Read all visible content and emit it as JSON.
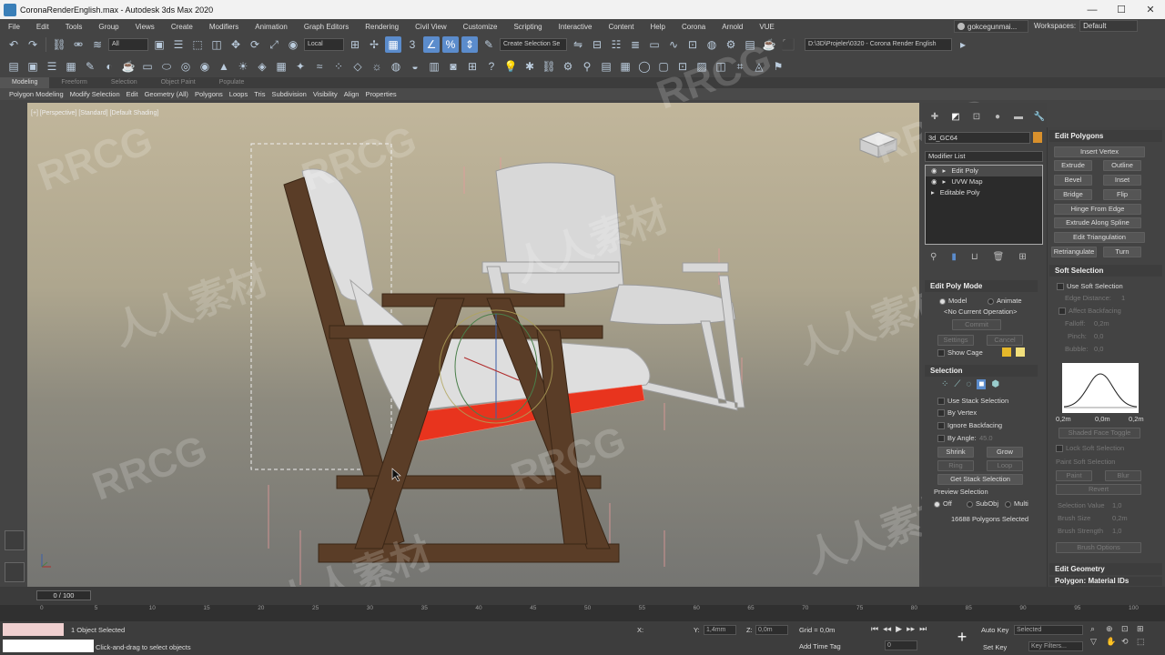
{
  "window": {
    "title": "CoronaRenderEnglish.max - Autodesk 3ds Max 2020",
    "controls": [
      "—",
      "☐",
      "✕"
    ]
  },
  "menu": [
    "File",
    "Edit",
    "Tools",
    "Group",
    "Views",
    "Create",
    "Modifiers",
    "Animation",
    "Graph Editors",
    "Rendering",
    "Civil View",
    "Customize",
    "Scripting",
    "Interactive",
    "Content",
    "Help",
    "Corona",
    "Arnold",
    "VUE"
  ],
  "user": {
    "name": "gokcegunmai..."
  },
  "workspaces": {
    "label": "Workspaces:",
    "value": "Default"
  },
  "toolbar1": {
    "selection_filter": "All",
    "ref_coord": "Local",
    "named_sel": "Create Selection Se",
    "project_path": "D:\\3D\\Projeler\\0320 - Corona Render English"
  },
  "ribbon": {
    "tabs": [
      "Modeling",
      "Freeform",
      "Selection",
      "Object Paint",
      "Populate"
    ],
    "sub": [
      "Polygon Modeling",
      "Modify Selection",
      "Edit",
      "Geometry (All)",
      "Polygons",
      "Loops",
      "Tris",
      "Subdivision",
      "Visibility",
      "Align",
      "Properties"
    ]
  },
  "viewport": {
    "label": "[+] [Perspective] [Standard] [Default Shading]"
  },
  "modify": {
    "object_name": "3d_GC64",
    "modifier_list": "Modifier List",
    "stack": [
      "Edit Poly",
      "UVW Map",
      "Editable Poly"
    ],
    "edit_poly_mode": {
      "title": "Edit Poly Mode",
      "model": "Model",
      "animate": "Animate",
      "op": "<No Current Operation>",
      "commit": "Commit",
      "settings": "Settings",
      "cancel": "Cancel",
      "show_cage": "Show Cage"
    },
    "selection": {
      "title": "Selection",
      "use_stack": "Use Stack Selection",
      "by_vertex": "By Vertex",
      "ignore_backfacing": "Ignore Backfacing",
      "by_angle": "By Angle:",
      "by_angle_val": "45.0",
      "shrink": "Shrink",
      "grow": "Grow",
      "ring": "Ring",
      "loop": "Loop",
      "get_stack": "Get Stack Selection",
      "preview": "Preview Selection",
      "off": "Off",
      "subobj": "SubObj",
      "multi": "Multi",
      "count": "16688 Polygons Selected"
    }
  },
  "cmd": {
    "edit_polygons": {
      "title": "Edit Polygons",
      "insert_vertex": "Insert Vertex",
      "extrude": "Extrude",
      "outline": "Outline",
      "bevel": "Bevel",
      "inset": "Inset",
      "bridge": "Bridge",
      "flip": "Flip",
      "hinge": "Hinge From Edge",
      "extrude_spline": "Extrude Along Spline",
      "edit_tri": "Edit Triangulation",
      "retriangulate": "Retriangulate",
      "turn": "Turn"
    },
    "soft_selection": {
      "title": "Soft Selection",
      "use_soft": "Use Soft Selection",
      "edge_distance": "Edge Distance:",
      "edge_val": "1",
      "affect_backfacing": "Affect Backfacing",
      "falloff": "Falloff:",
      "falloff_val": "0,2m",
      "pinch": "Pinch:",
      "pinch_val": "0,0",
      "bubble": "Bubble:",
      "bubble_val": "0,0",
      "curve_labels": [
        "0,2m",
        "0,0m",
        "0,2m"
      ],
      "shaded_face": "Shaded Face Toggle",
      "lock_soft": "Lock Soft Selection",
      "paint_soft": "Paint Soft Selection",
      "paint": "Paint",
      "blur": "Blur",
      "revert": "Revert",
      "sel_value": "Selection Value",
      "sel_value_val": "1,0",
      "brush_size": "Brush Size",
      "brush_size_val": "0,2m",
      "brush_strength": "Brush Strength",
      "brush_strength_val": "1,0",
      "brush_options": "Brush Options"
    },
    "edit_geometry": "Edit Geometry",
    "polygon_material": "Polygon: Material IDs"
  },
  "timeline": {
    "frame": "0 / 100",
    "ticks": [
      "0",
      "5",
      "10",
      "15",
      "20",
      "25",
      "30",
      "35",
      "40",
      "45",
      "50",
      "55",
      "60",
      "65",
      "70",
      "75",
      "80",
      "85",
      "90",
      "95",
      "100"
    ]
  },
  "status": {
    "selected": "1 Object Selected",
    "prompt": "Click-and-drag to select objects",
    "x_label": "X:",
    "y_label": "Y:",
    "y_val": "1,4mm",
    "z_label": "Z:",
    "z_val": "0,0m",
    "grid": "Grid = 0,0m",
    "add_time_tag": "Add Time Tag",
    "auto_key": "Auto Key",
    "set_key": "Set Key",
    "key_sel": "Selected",
    "key_filters": "Key Filters...",
    "frame": "0"
  },
  "watermarks": [
    "RRCG",
    "人人素材",
    "RRCG",
    "人人素材",
    "RRCG",
    "人人素材",
    "RRCG",
    "人人素材",
    "RRCG",
    "人人素材",
    "RRCG"
  ],
  "colors": {
    "accent": "#5b8ccc",
    "selection_red": "#e8341e",
    "wood": "#5a3d27",
    "cushion": "#dcdcdc"
  }
}
